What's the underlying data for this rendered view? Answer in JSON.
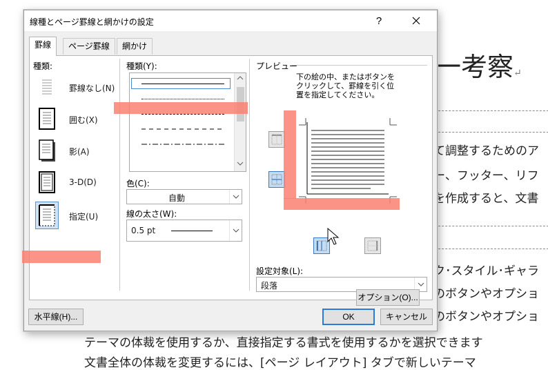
{
  "document": {
    "title": "一考察",
    "paragraph_mark": "↵",
    "lines": [
      "て調整するためのア",
      "ー、フッター、リフ",
      "を作成すると、文書",
      "ク･スタイル･ギャラ",
      "のボタンやオプショ",
      "のボタンやオプショ",
      "テーマの体裁を使用するか、直接指定する書式を使用するかを選択できます",
      "文書全体の体裁を変更するには、[ページ レイアウト] タブで新しいテーマ"
    ]
  },
  "dialog": {
    "title": "線種とページ罫線と網かけの設定",
    "help_label": "?",
    "tabs": [
      {
        "label": "罫線",
        "active": true
      },
      {
        "label": "ページ罫線",
        "active": false
      },
      {
        "label": "網かけ",
        "active": false
      }
    ],
    "settings_label": "種類:",
    "settings": [
      {
        "label": "罫線なし(N)",
        "icon": "border-none-icon",
        "selected": false
      },
      {
        "label": "囲む(X)",
        "icon": "border-box-icon",
        "selected": false
      },
      {
        "label": "影(A)",
        "icon": "border-shadow-icon",
        "selected": false
      },
      {
        "label": "3-D(D)",
        "icon": "border-3d-icon",
        "selected": false
      },
      {
        "label": "指定(U)",
        "icon": "border-custom-icon",
        "selected": true
      }
    ],
    "style_label": "種類(Y):",
    "color_label": "色(C):",
    "color_value": "自動",
    "width_label": "線の太さ(W):",
    "width_value": "0.5 pt",
    "preview_label": "プレビュー",
    "preview_instructions": [
      "下の絵の中、またはボタンを",
      "クリックして、罫線を引く位",
      "置を指定してください。"
    ],
    "apply_to_label": "設定対象(L):",
    "apply_to_value": "段落",
    "options_button": "オプション(O)...",
    "horizontal_line_button": "水平線(H)...",
    "ok_button": "OK",
    "cancel_button": "キャンセル"
  },
  "colors": {
    "highlight": "#fa8072",
    "accent": "#2a7bd8"
  }
}
